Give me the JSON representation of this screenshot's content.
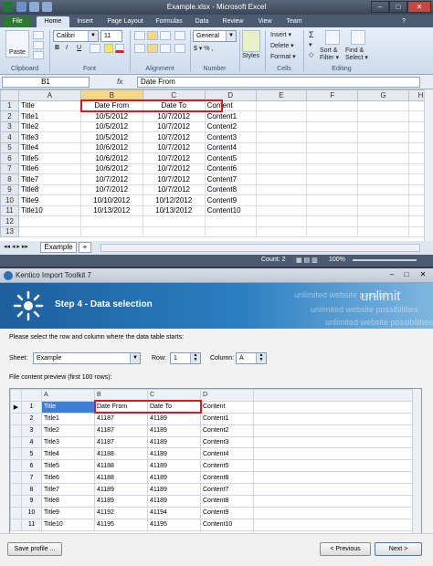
{
  "excel": {
    "window_title": "Example.xlsx - Microsoft Excel",
    "tabs": [
      "File",
      "Home",
      "Insert",
      "Page Layout",
      "Formulas",
      "Data",
      "Review",
      "View",
      "Team"
    ],
    "active_tab": "Home",
    "ribbon": {
      "paste_label": "Paste",
      "font_name": "Calibri",
      "font_size": "11",
      "number_format": "General",
      "bold": "B",
      "italic": "I",
      "underline": "U",
      "currency": "$ ▾ % ,",
      "insert_label": "Insert ▾",
      "delete_label": "Delete ▾",
      "format_label": "Format ▾",
      "styles_label": "Styles",
      "sort_filter_label": "Sort & Filter ▾",
      "find_select_label": "Find & Select ▾",
      "groups": [
        "Clipboard",
        "Font",
        "Alignment",
        "Number",
        "Cells",
        "Editing"
      ]
    },
    "name_box": "B1",
    "fx_label": "fx",
    "formula_value": "Date From",
    "columns": [
      "A",
      "B",
      "C",
      "D",
      "E",
      "F",
      "G",
      "H"
    ],
    "row_numbers": [
      "1",
      "2",
      "3",
      "4",
      "5",
      "6",
      "7",
      "8",
      "9",
      "10",
      "11",
      "12",
      "13"
    ],
    "rows": [
      [
        "Title",
        "Date From",
        "Date To",
        "Content"
      ],
      [
        "Title1",
        "10/5/2012",
        "10/7/2012",
        "Content1"
      ],
      [
        "Title2",
        "10/5/2012",
        "10/7/2012",
        "Content2"
      ],
      [
        "Title3",
        "10/5/2012",
        "10/7/2012",
        "Content3"
      ],
      [
        "Title4",
        "10/6/2012",
        "10/7/2012",
        "Content4"
      ],
      [
        "Title5",
        "10/6/2012",
        "10/7/2012",
        "Content5"
      ],
      [
        "Title6",
        "10/6/2012",
        "10/7/2012",
        "Content6"
      ],
      [
        "Title7",
        "10/7/2012",
        "10/7/2012",
        "Content7"
      ],
      [
        "Title8",
        "10/7/2012",
        "10/7/2012",
        "Content8"
      ],
      [
        "Title9",
        "10/10/2012",
        "10/12/2012",
        "Content9"
      ],
      [
        "Title10",
        "10/13/2012",
        "10/13/2012",
        "Content10"
      ]
    ],
    "sheet_tab": "Example",
    "status_count": "Count: 2",
    "zoom": "100%"
  },
  "kentico": {
    "window_title": "Kentico Import Toolkit 7",
    "step_title": "Step 4 - Data selection",
    "header_deco": [
      "unlimit",
      "unlimited website possibil",
      "unlimited website possibilities",
      "unlimited website possibilities"
    ],
    "instruction": "Please select the row and column where the data table starts:",
    "sheet_label": "Sheet:",
    "sheet_value": "Example",
    "row_label": "Row:",
    "row_value": "1",
    "column_label": "Column:",
    "column_value": "A",
    "preview_label": "File content preview (first 100 rows):",
    "preview_columns": [
      "A",
      "B",
      "C",
      "D"
    ],
    "preview_rows": [
      [
        "1",
        "Title",
        "Date From",
        "Date To",
        "Content"
      ],
      [
        "2",
        "Title1",
        "41187",
        "41189",
        "Content1"
      ],
      [
        "3",
        "Title2",
        "41187",
        "41189",
        "Content2"
      ],
      [
        "4",
        "Title3",
        "41187",
        "41189",
        "Content3"
      ],
      [
        "5",
        "Title4",
        "41188",
        "41189",
        "Content4"
      ],
      [
        "6",
        "Title5",
        "41188",
        "41189",
        "Content5"
      ],
      [
        "7",
        "Title6",
        "41188",
        "41189",
        "Content6"
      ],
      [
        "8",
        "Title7",
        "41189",
        "41189",
        "Content7"
      ],
      [
        "9",
        "Title8",
        "41189",
        "41189",
        "Content8"
      ],
      [
        "10",
        "Title9",
        "41192",
        "41194",
        "Content9"
      ],
      [
        "11",
        "Title10",
        "41195",
        "41195",
        "Content10"
      ]
    ],
    "save_profile_label": "Save profile ...",
    "previous_label": "< Previous",
    "next_label": "Next >",
    "highlight_color": "#e0181e"
  }
}
